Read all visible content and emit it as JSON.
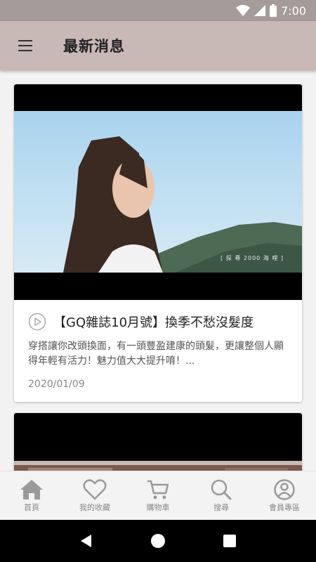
{
  "status_bar": {
    "time": "7:00"
  },
  "app_bar": {
    "title": "最新消息"
  },
  "articles": [
    {
      "title": "【GQ雜誌10月號】換季不愁沒髮度",
      "description": "穿搭讓你改頭換面，有一頭豐盈建康的頭髮，更讓整個人顯得年輕有活力！魅力值大大提升唷！...",
      "date": "2020/01/09",
      "video_caption": "[ 探 尋 2000 海 哩 ]"
    }
  ],
  "bottom_nav": [
    {
      "label": "首頁",
      "icon": "home-icon"
    },
    {
      "label": "我的收藏",
      "icon": "heart-icon"
    },
    {
      "label": "購物車",
      "icon": "cart-icon"
    },
    {
      "label": "搜尋",
      "icon": "search-icon"
    },
    {
      "label": "會員專區",
      "icon": "user-icon"
    }
  ],
  "colors": {
    "app_bar": "#c8b8b6",
    "status_bar": "#a59b9b",
    "icon_gray": "#9a9a9a"
  }
}
